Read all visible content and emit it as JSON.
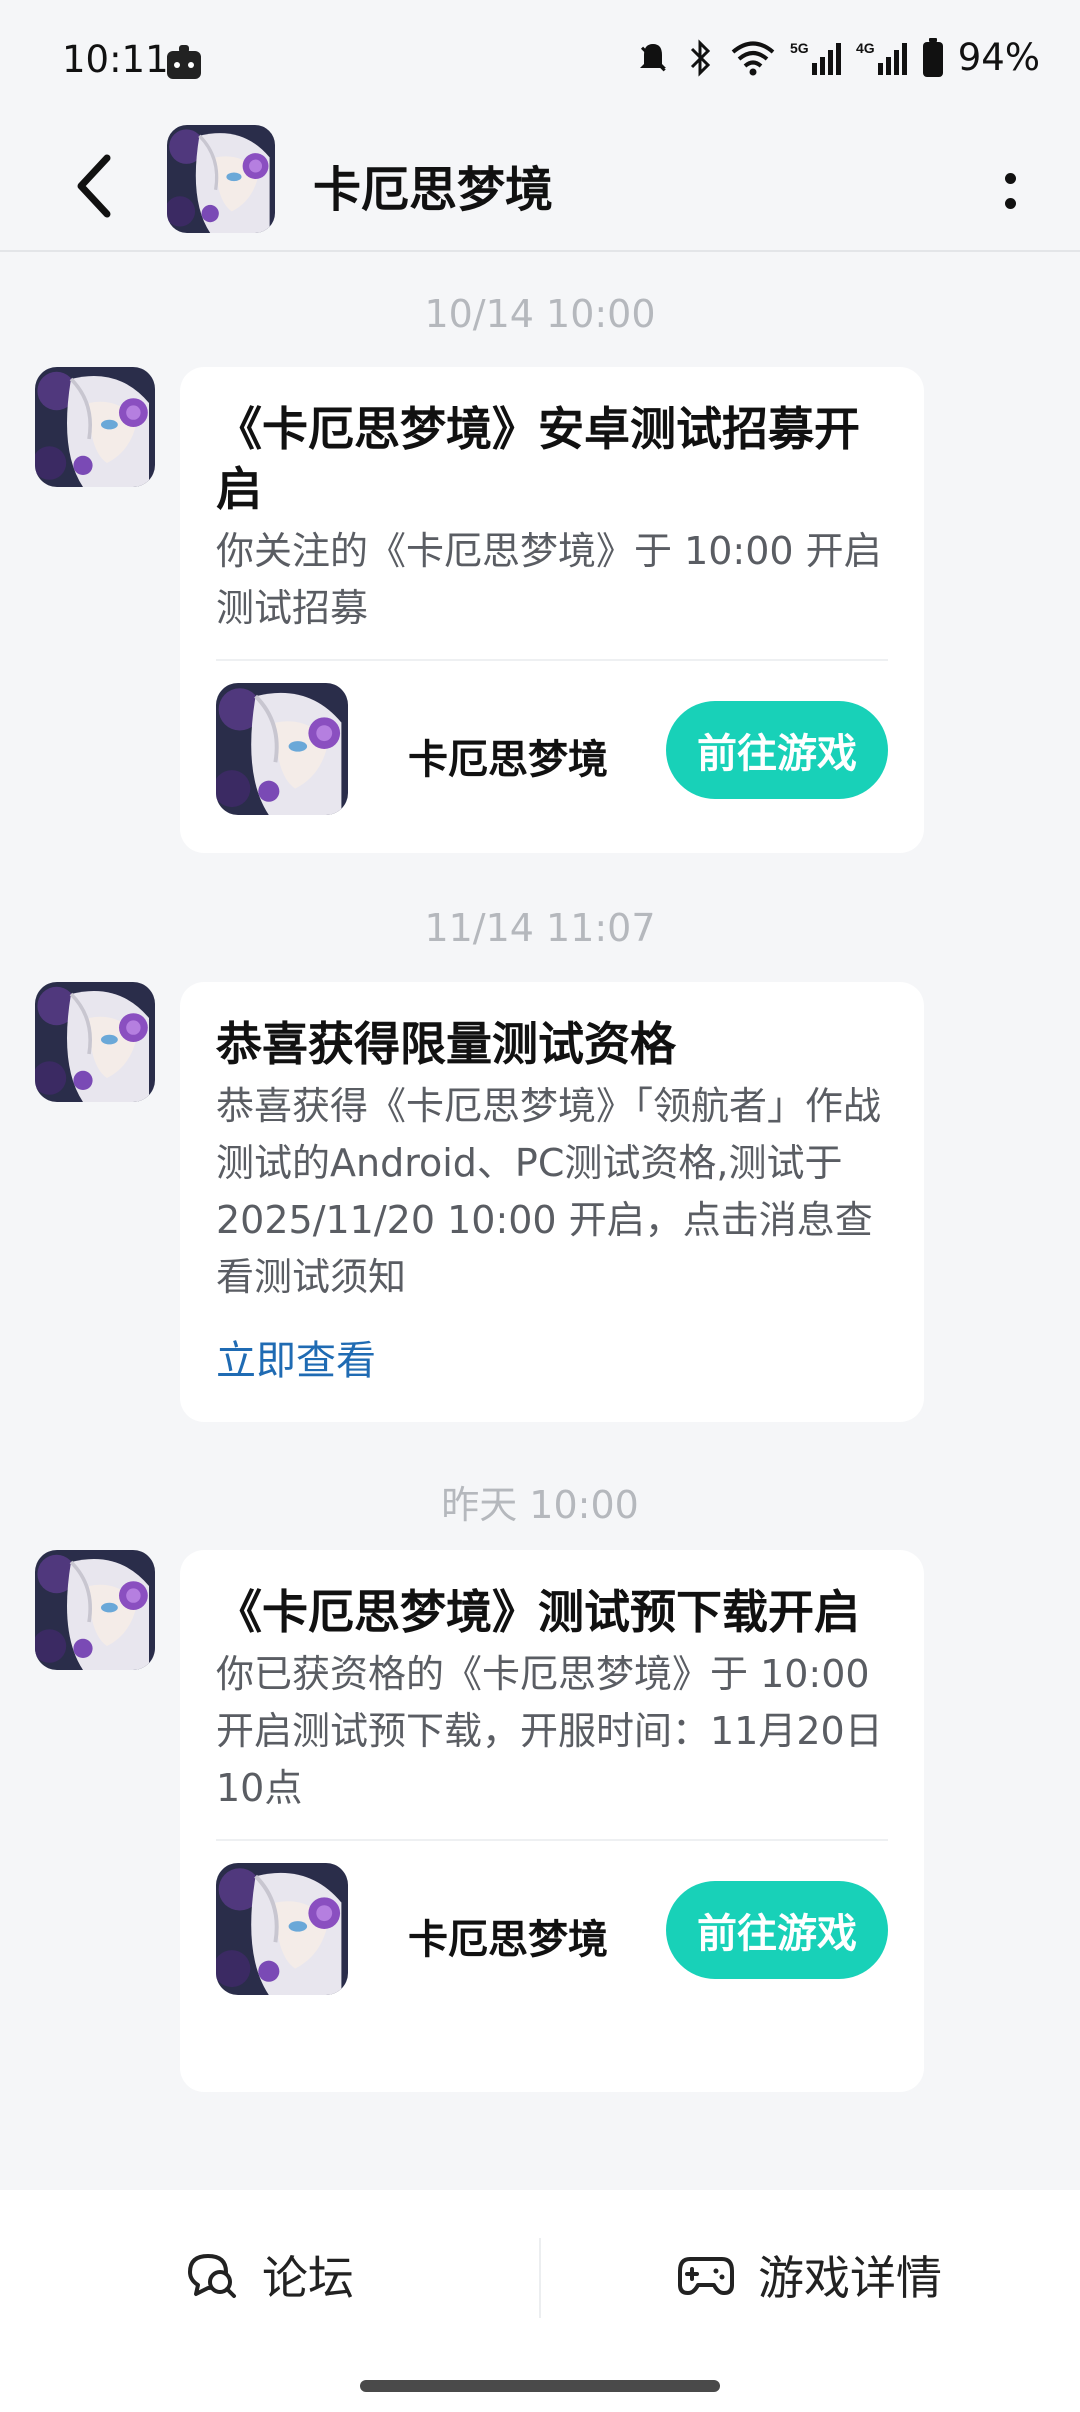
{
  "status_bar": {
    "time": "10:11",
    "battery": "94%",
    "icons": [
      "app-notification-icon",
      "mute-icon",
      "bluetooth-icon",
      "wifi-icon",
      "signal-5g-icon",
      "signal-4g-icon",
      "battery-icon"
    ]
  },
  "header": {
    "title": "卡厄思梦境",
    "back_icon": "back-arrow-icon",
    "more_icon": "more-vertical-icon"
  },
  "messages": [
    {
      "timestamp": "10/14  10:00",
      "title": "《卡厄思梦境》安卓测试招募开启",
      "body": "你关注的《卡厄思梦境》于 10:00 开启测试招募",
      "game_name": "卡厄思梦境",
      "button": "前往游戏"
    },
    {
      "timestamp": "11/14  11:07",
      "title": "恭喜获得限量测试资格",
      "body": "恭喜获得《卡厄思梦境》「领航者」作战测试的Android、PC测试资格,测试于 2025/11/20 10:00 开启，点击消息查看测试须知",
      "link": "立即查看"
    },
    {
      "timestamp": "昨天  10:00",
      "title": "《卡厄思梦境》测试预下载开启",
      "body": "你已获资格的《卡厄思梦境》于 10:00 开启测试预下载，开服时间：11月20日10点",
      "game_name": "卡厄思梦境",
      "button": "前往游戏"
    }
  ],
  "bottom_bar": {
    "forum": "论坛",
    "game_details": "游戏详情"
  },
  "colors": {
    "accent": "#18d1b8",
    "link": "#1f6bb3",
    "background": "#f5f6f8"
  }
}
